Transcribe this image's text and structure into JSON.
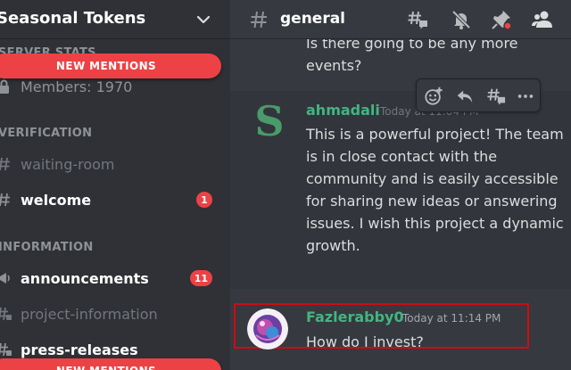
{
  "server": {
    "name": "Seasonal Tokens"
  },
  "sidebar": {
    "categories": {
      "server_stats": "SERVER STATS",
      "verification": "VERIFICATION",
      "information": "INFORMATION"
    },
    "members": "Members: 1970",
    "mention_pill": "NEW MENTIONS",
    "channels": [
      {
        "name": "waiting-room",
        "state": "muted"
      },
      {
        "name": "welcome",
        "state": "unread",
        "badge": "1"
      },
      {
        "name": "announcements",
        "state": "unread",
        "badge": "11"
      },
      {
        "name": "project-information",
        "state": "muted"
      },
      {
        "name": "press-releases",
        "state": "unread"
      }
    ]
  },
  "header": {
    "channel": "general"
  },
  "messages": {
    "previous_tail": "Is there going to be any more events?",
    "first": {
      "author": "ahmadali",
      "timestamp": "Today at 11:04 PM",
      "avatar_letter": "S",
      "body": "This is a powerful project! The team is in close contact with the community and is easily accessible for sharing new ideas or answering issues. I wish this project a dynamic growth."
    },
    "second": {
      "author": "Fazlerabby0",
      "timestamp": "Today at 11:14 PM",
      "body": "How do I invest?"
    }
  },
  "colors": {
    "accent_green": "#43b581",
    "mention_red": "#ed4245",
    "highlight_red": "#d10a10"
  }
}
